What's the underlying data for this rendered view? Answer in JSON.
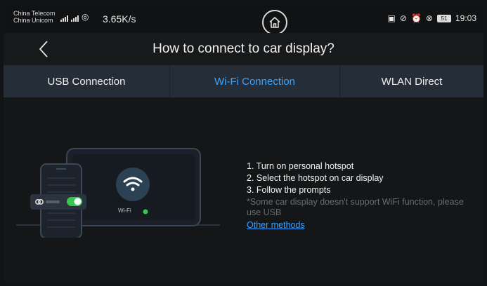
{
  "status_bar": {
    "carrier_1": "China Telecom",
    "carrier_2": "China Unicom",
    "net_speed": "3.65K/s",
    "battery_level": "51",
    "time": "19:03",
    "home_icon": "home-icon"
  },
  "header": {
    "title": "How to connect to car display?",
    "back_icon": "chevron-left-icon"
  },
  "tabs": [
    {
      "label": "USB Connection",
      "active": false
    },
    {
      "label": "Wi-Fi Connection",
      "active": true
    },
    {
      "label": "WLAN Direct",
      "active": false
    }
  ],
  "illustration": {
    "wifi_label": "Wi-Fi"
  },
  "instructions": {
    "steps": [
      "1. Turn on personal hotspot",
      "2. Select the hotspot on car display",
      "3. Follow the prompts"
    ],
    "note": "*Some car display doesn't support WiFi function, please use USB",
    "link": "Other methods"
  },
  "colors": {
    "accent": "#3aa3ff",
    "tab_bar": "#252e38",
    "background": "#141618",
    "toggle_on": "#39c64f"
  }
}
